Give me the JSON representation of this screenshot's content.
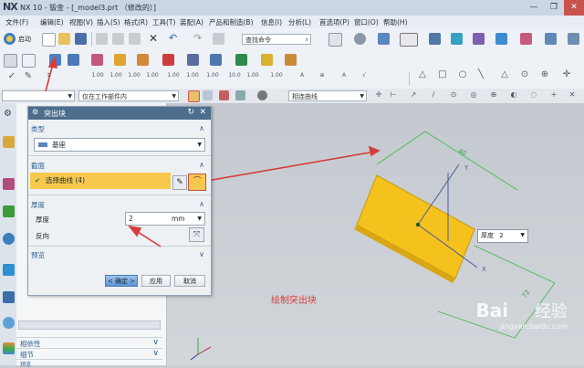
{
  "window": {
    "logo": "NX",
    "title": "NX 10 - 钣金 - [_model3.prt （修改的）]",
    "buttons": [
      "—",
      "❐",
      "✕"
    ]
  },
  "menubar": {
    "items": [
      "文件(F)",
      "编辑(E)",
      "视图(V)",
      "插入(S)",
      "格式(R)",
      "工具(T)",
      "装配(A)",
      "产品和制造(B)",
      "信息(I)",
      "分析(L)",
      "首选项(P)",
      "窗口(O)",
      "帮助(H)"
    ]
  },
  "toolbar": {
    "start_label": "启动",
    "command_search_placeholder": "查找命令"
  },
  "selection_bar": {
    "filter_value": "仅在工作部件内",
    "curve_rule_value": "相连曲线"
  },
  "dialog": {
    "title": "突出块",
    "type_section": "类型",
    "type_value": "基座",
    "section_section": "截面",
    "select_curve_label": "选择曲线 (4)",
    "thickness_section": "厚度",
    "thickness_label": "厚度",
    "thickness_value": "2",
    "thickness_unit": "mm",
    "reverse_label": "反向",
    "preview_section": "预览",
    "ok_label": "< 确定 >",
    "apply_label": "应用",
    "cancel_label": "取消"
  },
  "navigator": {
    "related_label": "相依性",
    "details_label": "细节",
    "preview_label": "预览"
  },
  "viewport": {
    "thickness_tag_label": "厚度",
    "thickness_tag_value": "2",
    "caption": "绘制突出块",
    "dim_top": "40",
    "dim_right": "72",
    "axis_x": "X",
    "axis_y": "Y"
  },
  "watermark": {
    "brand": "Bai",
    "brand2": "经验",
    "url": "jingyan.baidu.com"
  }
}
